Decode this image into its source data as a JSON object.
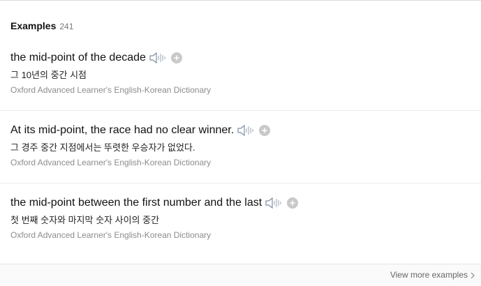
{
  "header": {
    "title": "Examples",
    "count": "241"
  },
  "examples": [
    {
      "sentence": "the mid-point of the decade",
      "translation": "그 10년의 중간 시점",
      "source": "Oxford Advanced Learner's English-Korean Dictionary"
    },
    {
      "sentence": "At its mid-point, the race had no clear winner.",
      "translation": "그 경주 중간 지점에서는 뚜렷한 우승자가 없었다.",
      "source": "Oxford Advanced Learner's English-Korean Dictionary"
    },
    {
      "sentence": "the mid-point between the first number and the last",
      "translation": "첫 번째 숫자와 마지막 숫자 사이의 중간",
      "source": "Oxford Advanced Learner's English-Korean Dictionary"
    }
  ],
  "footer": {
    "view_more_label": "View more examples"
  },
  "icons": {
    "audio": "speaker-icon",
    "add": "plus-circle-icon",
    "more": "chevron-right-icon"
  },
  "colors": {
    "icon_gray": "#b5b5b5",
    "speaker_blue_gray": "#7f8ea3"
  }
}
